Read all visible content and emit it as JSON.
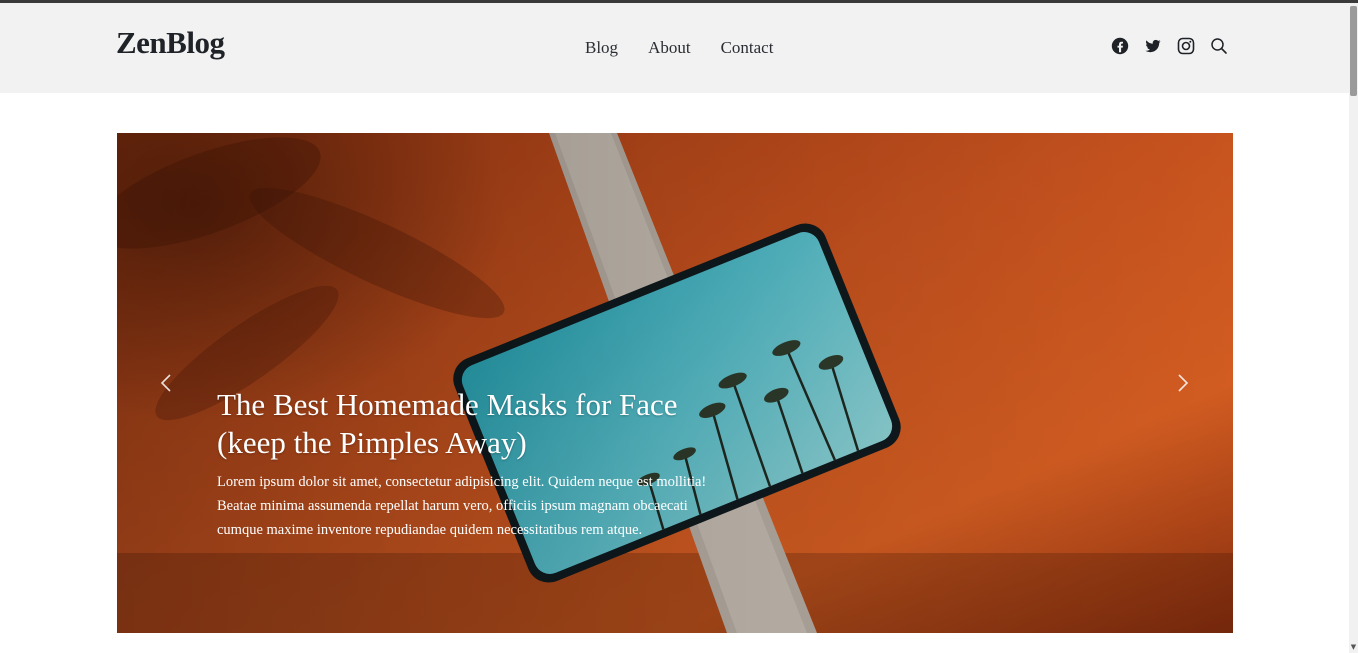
{
  "site": {
    "logo": "ZenBlog"
  },
  "nav": {
    "items": [
      {
        "label": "Blog"
      },
      {
        "label": "About"
      },
      {
        "label": "Contact"
      }
    ]
  },
  "header_icons": [
    "facebook-icon",
    "twitter-icon",
    "instagram-icon",
    "search-icon"
  ],
  "hero": {
    "slide": {
      "title": "The Best Homemade Masks for Face (keep the Pimples Away)",
      "body": "Lorem ipsum dolor sit amet, consectetur adipisicing elit. Quidem neque est mollitia! Beatae minima assumenda repellat harum vero, officiis ipsum magnam obcaecati cumque maxime inventore repudiandae quidem necessitatibus rem atque."
    },
    "prev_icon": "chevron-left-icon",
    "next_icon": "chevron-right-icon"
  },
  "colors": {
    "header_bg": "#f2f2f2",
    "text_dark": "#1f2327",
    "hero_orange": "#b8481b",
    "tablet_screen": "#2fb3c4"
  }
}
